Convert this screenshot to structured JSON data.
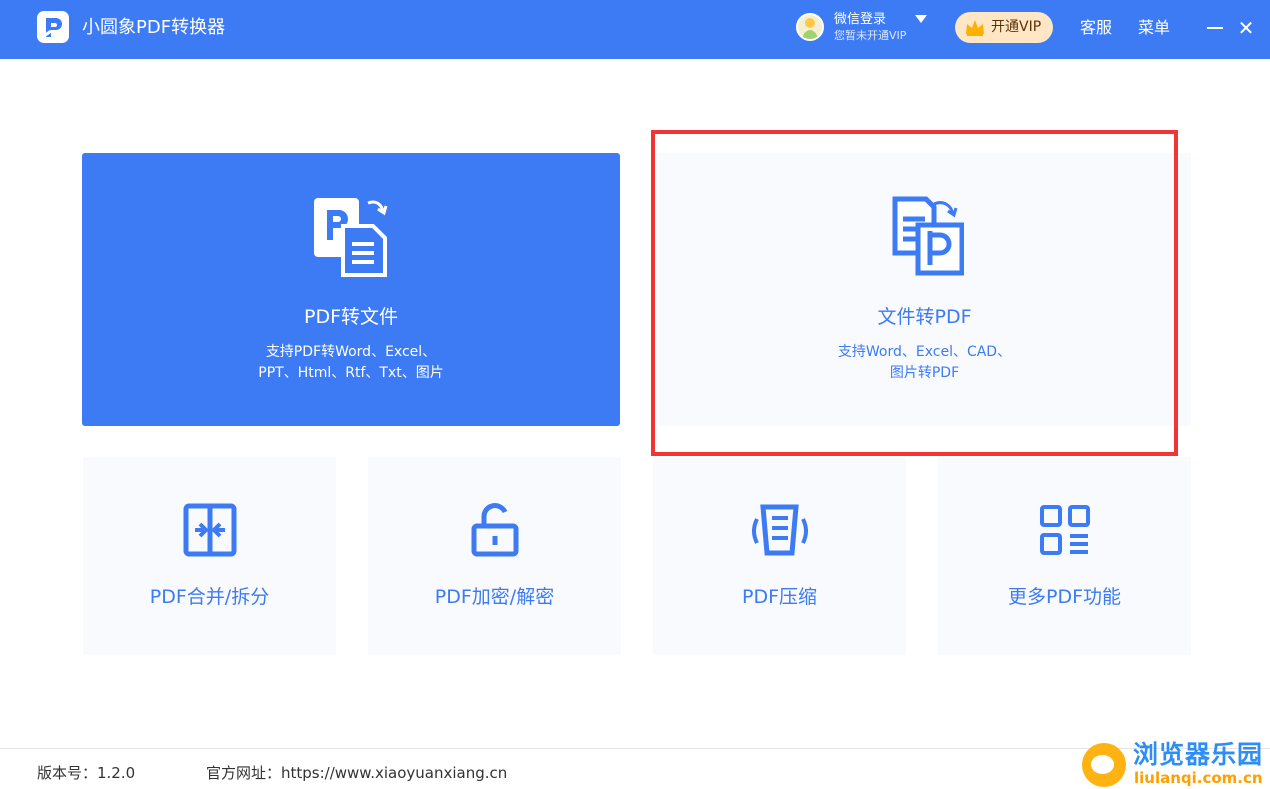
{
  "app": {
    "title": "小圆象PDF转换器",
    "accent_color": "#3d7bf5",
    "window_controls": [
      "minimize-icon",
      "close-icon"
    ]
  },
  "header": {
    "login_title": "微信登录",
    "login_status": "您暂未开通VIP",
    "vip_label": "开通VIP",
    "service_label": "客服",
    "menu_label": "菜单"
  },
  "cards": {
    "pdf_to_file": {
      "title": "PDF转文件",
      "desc_line1": "支持PDF转Word、Excel、",
      "desc_line2": "PPT、Html、Rtf、Txt、图片",
      "icon": "pdf-to-file-icon"
    },
    "file_to_pdf": {
      "title": "文件转PDF",
      "desc_line1": "支持Word、Excel、CAD、",
      "desc_line2": "图片转PDF",
      "icon": "file-to-pdf-icon",
      "highlight_color": "#f13434"
    },
    "tools": [
      {
        "title": "PDF合并/拆分",
        "icon": "merge-split-icon"
      },
      {
        "title": "PDF加密/解密",
        "icon": "unlock-icon"
      },
      {
        "title": "PDF压缩",
        "icon": "compress-icon"
      },
      {
        "title": "更多PDF功能",
        "icon": "more-functions-icon"
      }
    ]
  },
  "footer": {
    "version_label": "版本号：1.2.0",
    "website_label": "官方网址：https://www.xiaoyuanxiang.cn"
  },
  "watermark": {
    "title": "浏览器乐园",
    "url": "liulanqi.com.cn"
  }
}
